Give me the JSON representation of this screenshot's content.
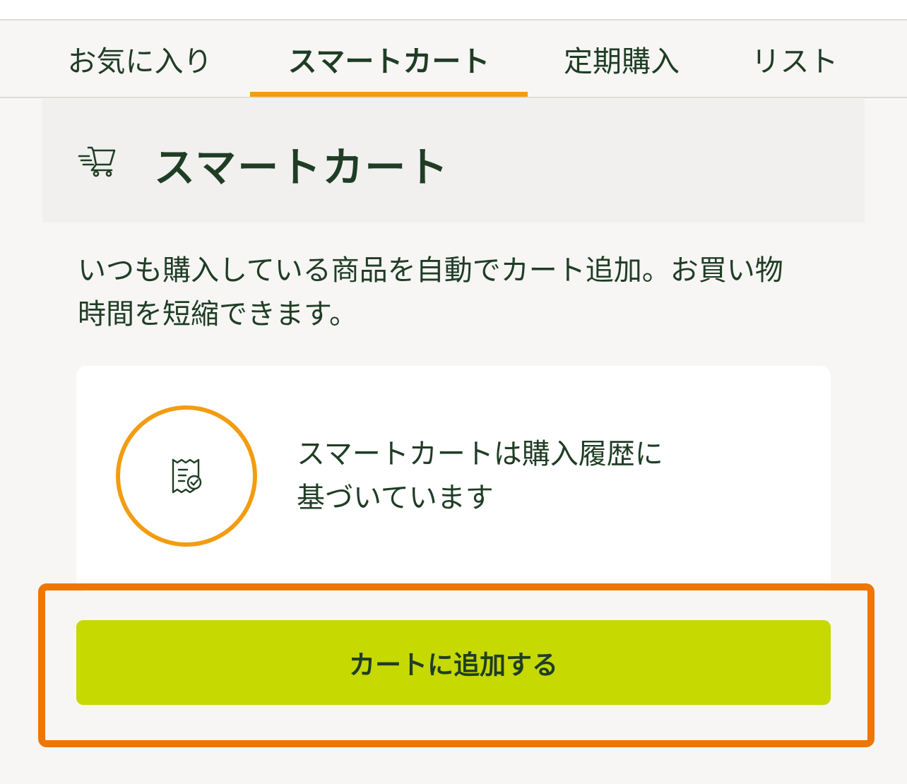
{
  "tabs": [
    {
      "label": "お気に入り",
      "active": false
    },
    {
      "label": "スマートカート",
      "active": true
    },
    {
      "label": "定期購入",
      "active": false
    },
    {
      "label": "リスト",
      "active": false
    }
  ],
  "section": {
    "icon": "smart-cart-icon",
    "title": "スマートカート"
  },
  "description": {
    "line1": "いつも購入している商品を自動でカート追加。お買い物",
    "line2": "時間を短縮できます。"
  },
  "info_card": {
    "icon": "receipt-check-icon",
    "line1": "スマートカートは購入履歴に",
    "line2": "基づいています"
  },
  "actions": {
    "add_to_cart_label": "カートに追加する"
  },
  "colors": {
    "accent_orange": "#f29c10",
    "highlight_frame": "#ee7604",
    "button_lime": "#c6d900",
    "text_green": "#1f3d25"
  }
}
